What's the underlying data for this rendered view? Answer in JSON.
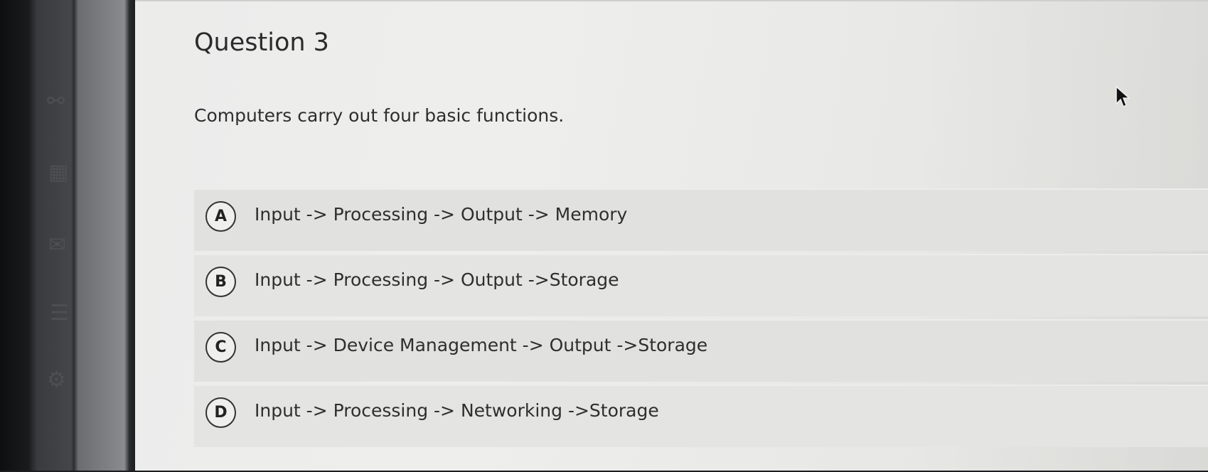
{
  "question": {
    "title": "Question 3",
    "text": "Computers carry out four basic functions."
  },
  "options": [
    {
      "letter": "A",
      "text": "Input -> Processing -> Output -> Memory"
    },
    {
      "letter": "B",
      "text": "Input -> Processing -> Output ->Storage"
    },
    {
      "letter": "C",
      "text": "Input -> Device Management -> Output ->Storage"
    },
    {
      "letter": "D",
      "text": "Input -> Processing -> Networking ->Storage"
    }
  ],
  "sidebar_icons": [
    "link-icon",
    "calendar-icon",
    "mail-icon",
    "document-icon",
    "settings-icon"
  ],
  "colors": {
    "background": "#ececeb",
    "option_background": "#e1e1df",
    "text": "#2e2e2e"
  }
}
